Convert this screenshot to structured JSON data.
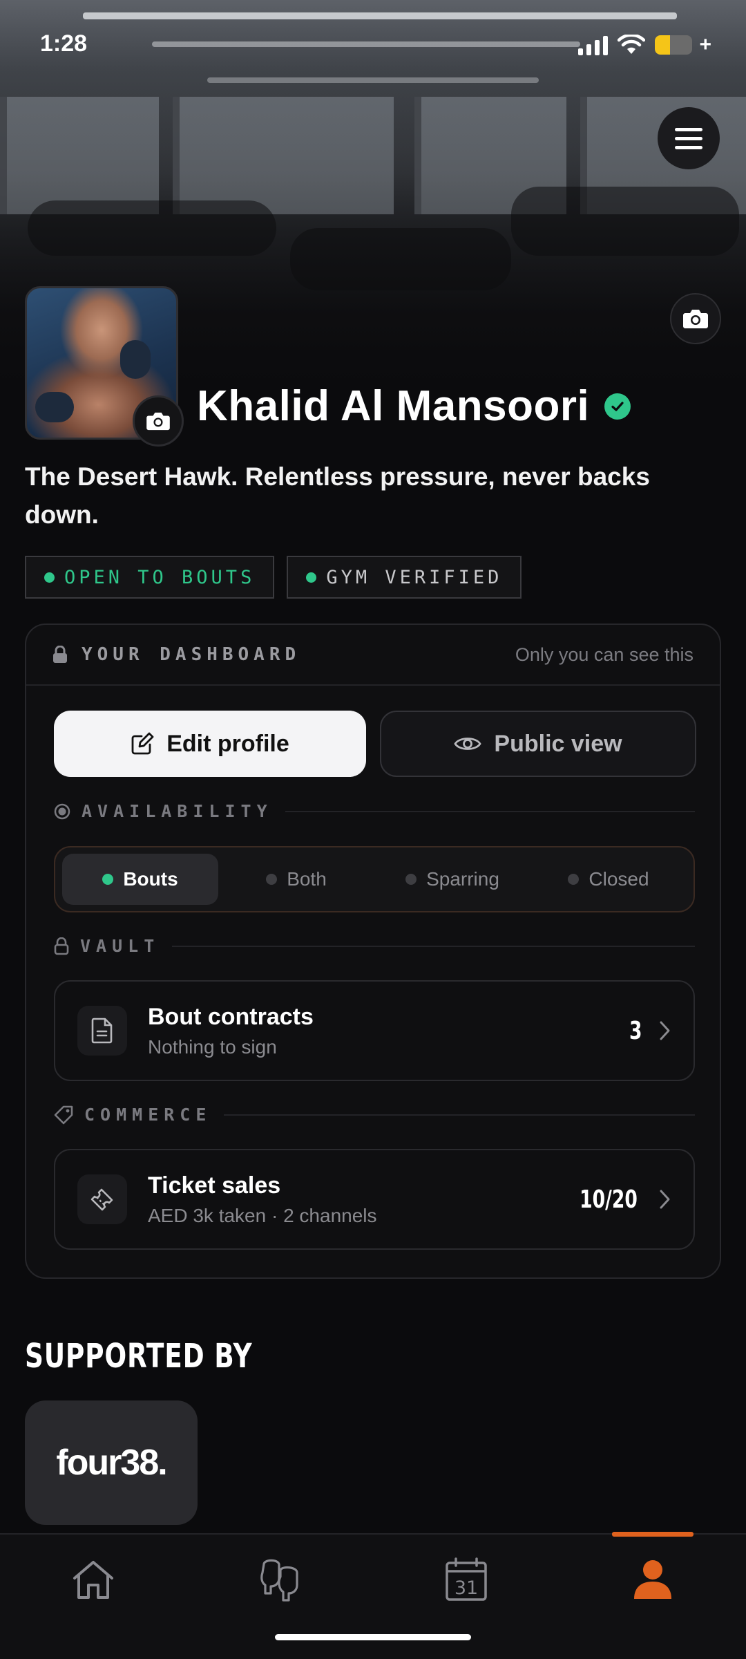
{
  "status_bar": {
    "time": "1:28",
    "battery_level": 0.4
  },
  "profile": {
    "name": "Khalid Al Mansoori",
    "verified": true,
    "bio": "The Desert Hawk. Relentless pressure, never backs down.",
    "tags": [
      "OPEN TO BOUTS",
      "GYM VERIFIED"
    ]
  },
  "dashboard": {
    "title": "YOUR DASHBOARD",
    "note": "Only you can see this",
    "edit_label": "Edit profile",
    "public_label": "Public view",
    "availability": {
      "label": "AVAILABILITY",
      "options": [
        "Bouts",
        "Both",
        "Sparring",
        "Closed"
      ],
      "selected": "Bouts"
    },
    "vault": {
      "label": "VAULT",
      "title": "Bout contracts",
      "subtitle": "Nothing to sign",
      "count": "3"
    },
    "commerce": {
      "label": "COMMERCE",
      "title": "Ticket sales",
      "subtitle": "AED 3k taken · 2 channels",
      "count": "10/20"
    }
  },
  "supported": {
    "title": "SUPPORTED BY",
    "sponsor": "four38."
  },
  "nav": {
    "items": [
      "home-icon",
      "boxing-gloves-icon",
      "calendar-icon",
      "profile-icon"
    ],
    "calendar_day": "31",
    "active": "profile-icon"
  },
  "colors": {
    "accent": "#e0621e",
    "status_green": "#2fc78b",
    "background": "#0b0b0d"
  }
}
